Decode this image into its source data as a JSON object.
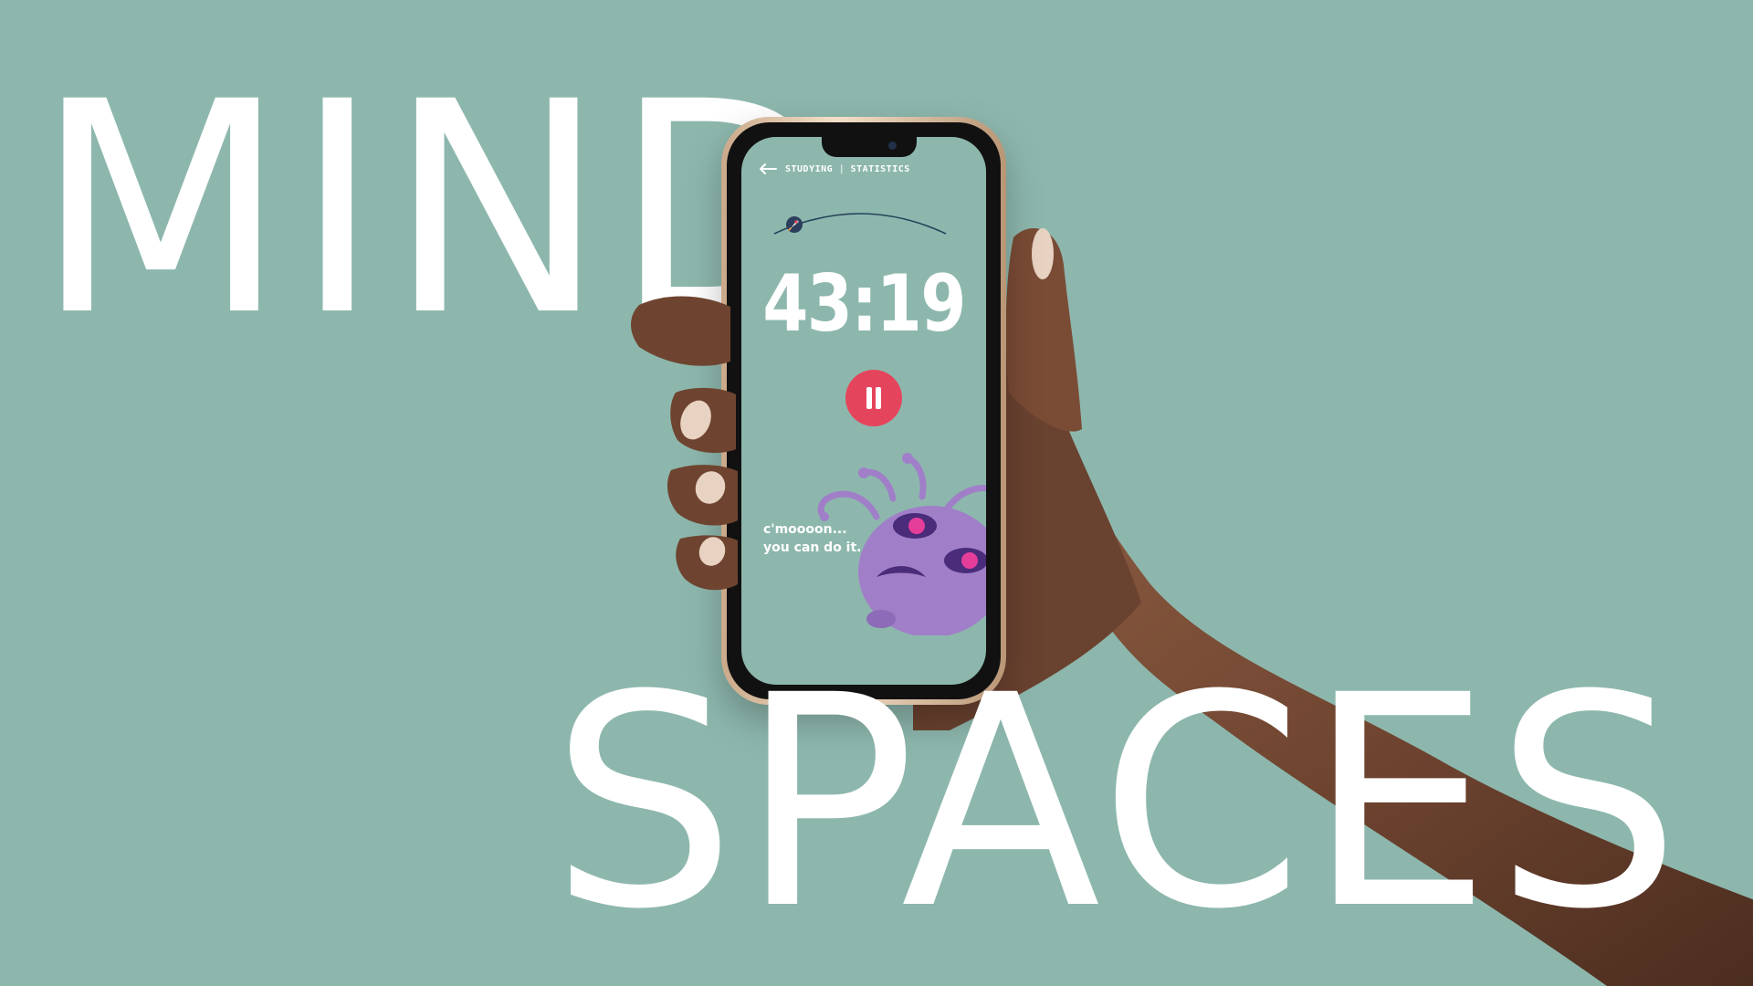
{
  "background": {
    "headline_top": "MIND",
    "headline_bottom": "SPACES",
    "color": "#8db7ad"
  },
  "app": {
    "nav": {
      "back_icon": "arrow-left-icon",
      "primary_label": "STUDYING",
      "separator": "|",
      "secondary_label": "STATISTICS"
    },
    "progress": {
      "icon": "rocket-icon"
    },
    "timer": "43:19",
    "pause_button": {
      "icon": "pause-icon",
      "color": "#e5455c"
    },
    "encouragement": {
      "line1": "c'moooon...",
      "line2": "you can do it."
    },
    "mascot": {
      "icon": "three-eyed-alien-icon",
      "color": "#a07fc8"
    }
  }
}
